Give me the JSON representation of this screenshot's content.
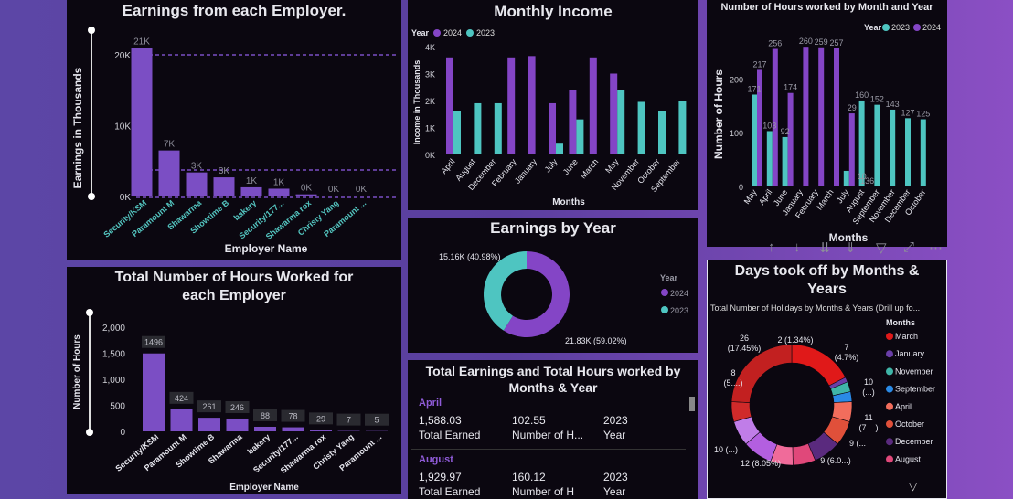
{
  "charts": {
    "earnings_employer": {
      "title": "Earnings from each Employer.",
      "xlabel": "Employer Name",
      "ylabel": "Earnings in Thousands",
      "ticks": [
        "20K",
        "10K",
        "0K"
      ],
      "data_labels": [
        "21K",
        "7K",
        "3K",
        "3K",
        "1K",
        "1K",
        "0K",
        "0K",
        "0K"
      ],
      "categories": [
        "Security/KSM",
        "Paramount M",
        "Shawarma",
        "Showtime B",
        "bakery",
        "Security/177...",
        "Shawarma rox",
        "Christy Yang",
        "Paramount ..."
      ]
    },
    "monthly_income": {
      "title": "Monthly Income",
      "legend_title": "Year",
      "legend": [
        "2024",
        "2023"
      ],
      "ylabel": "Income in Thousands",
      "xlabel": "Months",
      "ticks": [
        "4K",
        "3K",
        "2K",
        "1K",
        "0K"
      ],
      "categories": [
        "April",
        "August",
        "December",
        "February",
        "January",
        "July",
        "June",
        "March",
        "May",
        "November",
        "October",
        "September"
      ]
    },
    "hours_month_year": {
      "title": "Number of Hours worked by Month and Year",
      "legend_title": "Year",
      "legend": [
        "2023",
        "2024"
      ],
      "ylabel": "Number of Hours",
      "xlabel": "Months",
      "ticks": [
        "200",
        "100",
        "0"
      ],
      "categories": [
        "May",
        "April",
        "June",
        "January",
        "February",
        "March",
        "July",
        "August",
        "September",
        "November",
        "December",
        "October"
      ],
      "labels_2024": [
        "217",
        "256",
        "174",
        "260",
        "259",
        "257",
        "29",
        "136",
        "",
        "",
        "",
        ""
      ],
      "labels_2023": [
        "171",
        "103",
        "92",
        "",
        "",
        "",
        "",
        "160",
        "152",
        "143",
        "127",
        "125"
      ],
      "extra_labels": [
        "10"
      ]
    },
    "earnings_year": {
      "title": "Earnings by Year",
      "legend_title": "Year",
      "legend": [
        "2024",
        "2023"
      ],
      "label_2023": "15.16K (40.98%)",
      "label_2024": "21.83K (59.02%)"
    },
    "hours_employer": {
      "title": "Total Number of Hours Worked for each Employer",
      "ylabel": "Number of Hours",
      "xlabel": "Employer Name",
      "ticks": [
        "2,000",
        "1,500",
        "1,000",
        "500",
        "0"
      ],
      "data_labels": [
        "1496",
        "424",
        "261",
        "246",
        "88",
        "78",
        "29",
        "7",
        "5"
      ],
      "categories": [
        "Security/KSM",
        "Paramount M",
        "Showtime B",
        "Shawarma",
        "bakery",
        "Security/177...",
        "Shawarma rox",
        "Christy Yang",
        "Paramount ..."
      ]
    },
    "earnings_table": {
      "title": "Total Earnings and Total Hours worked by Months & Year",
      "rows": [
        {
          "month": "April",
          "earned": "1,588.03",
          "hours": "102.55",
          "year": "2023",
          "c1": "Total Earned",
          "c2": "Number of H...",
          "c3": "Year"
        },
        {
          "month": "August",
          "earned": "1,929.97",
          "hours": "160.12",
          "year": "2023",
          "c1": "Total Earned",
          "c2": "Number of H",
          "c3": "Year"
        }
      ]
    },
    "days_off": {
      "title": "Days took off by Months & Years",
      "subtitle": "Total Number of Holidays by Months & Years (Drill up fo...",
      "legend_title": "Months",
      "legend": [
        "March",
        "January",
        "November",
        "September",
        "April",
        "October",
        "December",
        "August"
      ],
      "labels": [
        "26\n(17.45%)",
        "2 (1.34%)",
        "7\n(4.7%)",
        "8\n(5....)",
        "10\n(...)",
        "11\n(7....)",
        "9 (...",
        "9 (6.0...)",
        "12 (8.05%)",
        "10 (...)"
      ]
    }
  },
  "chart_data": [
    {
      "type": "bar",
      "title": "Earnings from each Employer.",
      "xlabel": "Employer Name",
      "ylabel": "Earnings in Thousands",
      "categories": [
        "Security/KSM",
        "Paramount M",
        "Shawarma",
        "Showtime B",
        "bakery",
        "Security/177...",
        "Shawarma rox",
        "Christy Yang",
        "Paramount ..."
      ],
      "values": [
        21,
        6.5,
        3.4,
        2.7,
        1.3,
        1.1,
        0.3,
        0.1,
        0.1
      ],
      "ylim": [
        0,
        22
      ],
      "grid": false,
      "colors": {
        "bar": "#7b4ec4"
      }
    },
    {
      "type": "bar",
      "title": "Monthly Income",
      "xlabel": "Months",
      "ylabel": "Income in Thousands",
      "legend": "top-left",
      "categories": [
        "April",
        "August",
        "December",
        "February",
        "January",
        "July",
        "June",
        "March",
        "May",
        "November",
        "October",
        "September"
      ],
      "series": [
        {
          "name": "2024",
          "color": "#8445c6",
          "values": [
            3.6,
            0,
            0,
            3.6,
            3.65,
            1.9,
            2.4,
            3.6,
            3.0,
            0,
            0,
            0
          ]
        },
        {
          "name": "2023",
          "color": "#4ec5c1",
          "values": [
            1.6,
            1.9,
            1.9,
            0,
            0,
            0.4,
            1.3,
            0,
            2.4,
            1.95,
            1.6,
            2.0
          ]
        }
      ],
      "ylim": [
        0,
        4
      ]
    },
    {
      "type": "bar",
      "title": "Number of Hours worked by Month and Year",
      "xlabel": "Months",
      "ylabel": "Number of Hours",
      "legend": "top",
      "categories": [
        "May",
        "April",
        "June",
        "January",
        "February",
        "March",
        "July",
        "August",
        "September",
        "November",
        "December",
        "October"
      ],
      "series": [
        {
          "name": "2023",
          "color": "#4ec5c1",
          "values": [
            171,
            103,
            92,
            0,
            0,
            0,
            29,
            160,
            152,
            143,
            127,
            125
          ]
        },
        {
          "name": "2024",
          "color": "#8445c6",
          "values": [
            217,
            256,
            174,
            260,
            259,
            257,
            136,
            0,
            0,
            0,
            0,
            0
          ]
        }
      ],
      "ylim": [
        0,
        280
      ]
    },
    {
      "type": "pie",
      "title": "Earnings by Year",
      "legend": "right",
      "series": [
        {
          "name": "2024",
          "value": 21.83,
          "percent": 59.02,
          "color": "#8445c6"
        },
        {
          "name": "2023",
          "value": 15.16,
          "percent": 40.98,
          "color": "#4ec5c1"
        }
      ]
    },
    {
      "type": "bar",
      "title": "Total Number of Hours Worked for each Employer",
      "xlabel": "Employer Name",
      "ylabel": "Number of Hours",
      "categories": [
        "Security/KSM",
        "Paramount M",
        "Showtime B",
        "Shawarma",
        "bakery",
        "Security/177...",
        "Shawarma rox",
        "Christy Yang",
        "Paramount ..."
      ],
      "values": [
        1496,
        424,
        261,
        246,
        88,
        78,
        29,
        7,
        5
      ],
      "ylim": [
        0,
        2000
      ]
    },
    {
      "type": "pie",
      "title": "Days took off by Months & Years",
      "legend": "right",
      "slices": [
        {
          "label": "March",
          "value": 26,
          "color": "#e01919"
        },
        {
          "label": "January",
          "value": 2,
          "color": "#6a3ea8"
        },
        {
          "label": "November",
          "value": 4,
          "color": "#3fb5a8"
        },
        {
          "label": "September",
          "value": 4,
          "color": "#2a8ae6"
        },
        {
          "label": "April",
          "value": 8,
          "color": "#f26d5c"
        },
        {
          "label": "October",
          "value": 10,
          "color": "#e0503a"
        },
        {
          "label": "December",
          "value": 11,
          "color": "#5a2a7e"
        },
        {
          "label": "August",
          "value": 9,
          "color": "#e0487a"
        },
        {
          "label": "",
          "value": 9,
          "color": "#f06b9a"
        },
        {
          "label": "",
          "value": 12,
          "color": "#b35fe0"
        },
        {
          "label": "",
          "value": 10,
          "color": "#c07de8"
        },
        {
          "label": "",
          "value": 8,
          "color": "#d02a2a"
        },
        {
          "label": "",
          "value": 36,
          "color": "#c22020"
        }
      ]
    }
  ]
}
